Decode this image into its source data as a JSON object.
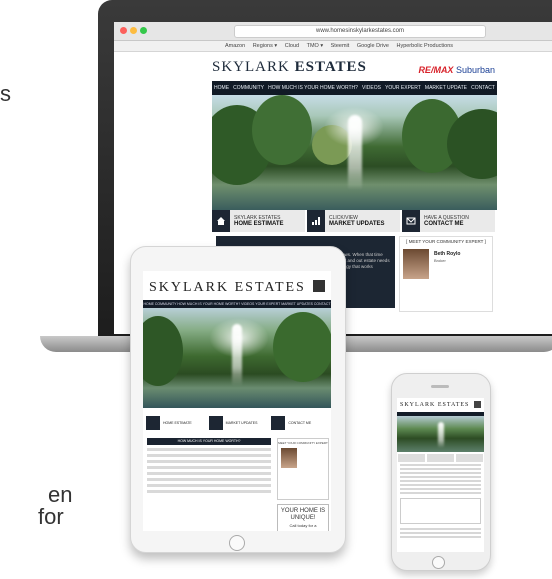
{
  "background_fragments": [
    "s",
    "en",
    "for"
  ],
  "browser": {
    "url": "www.homesinskylarkestates.com",
    "bookmarks": [
      "Amazon",
      "Regions ▾",
      "Cloud",
      "TMO ▾",
      "Steemit",
      "Google Drive",
      "Hyperbolic Productions"
    ]
  },
  "site": {
    "logo_light": "SKYLARK ",
    "logo_bold": "ESTATES",
    "brand_re": "RE/MAX",
    "brand_rest": " Suburban",
    "nav": [
      "HOME",
      "COMMUNITY",
      "HOW MUCH IS YOUR HOME WORTH?",
      "VIDEOS",
      "YOUR EXPERT",
      "MARKET UPDATE",
      "CONTACT"
    ],
    "tiles": [
      {
        "small": "SKYLARK ESTATES",
        "big": "HOME ESTIMATE"
      },
      {
        "small": "CLICK/VIEW",
        "big": "MARKET UPDATES"
      },
      {
        "small": "HAVE A QUESTION",
        "big": "CONTACT ME"
      }
    ],
    "community_expert": "MEET YOUR COMMUNITY EXPERT",
    "agent_name": "Beth Roylo",
    "agent_role": "Broker",
    "body_text": "know more about the real estate news. When that time arrives, it information that is relevant and out estate needs and take the time customize a strategy that works"
  },
  "tablet": {
    "logo": "SKYLARK ESTATES",
    "nav": [
      "HOME",
      "COMMUNITY",
      "HOW MUCH IS YOUR HOME WORTH?",
      "VIDEOS",
      "YOUR EXPERT",
      "MARKET UPDATES",
      "CONTACT"
    ],
    "tiles": [
      "HOME ESTIMATE",
      "MARKET UPDATES",
      "CONTACT ME"
    ],
    "section_bar": "HOW MUCH IS YOUR HOME WORTH?",
    "expert": "MEET YOUR COMMUNITY EXPERT",
    "home_text": "YOUR HOME IS UNIQUE!",
    "call_text": "Call today for a"
  },
  "phone": {
    "logo": "SKYLARK ESTATES"
  }
}
